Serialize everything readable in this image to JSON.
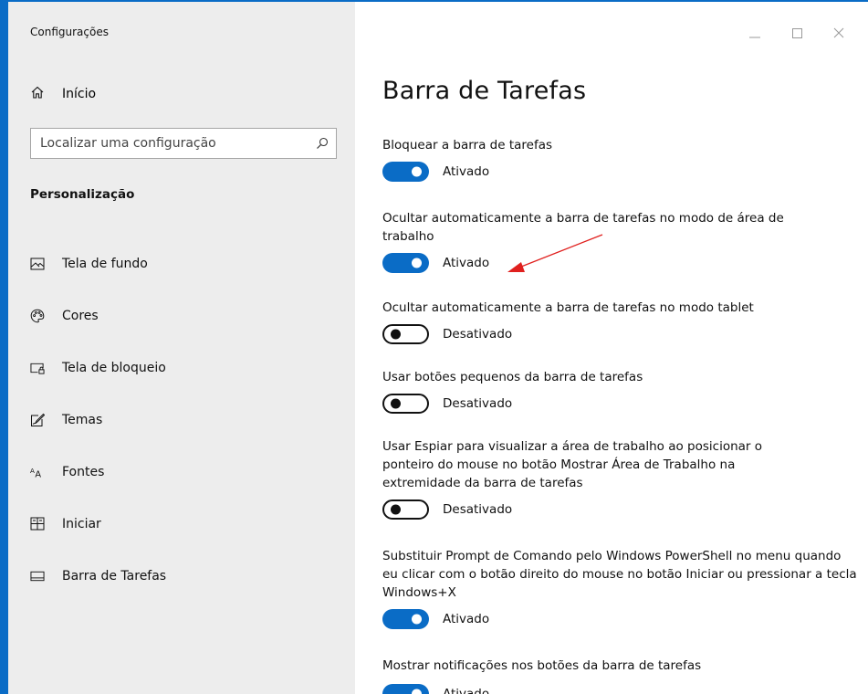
{
  "window": {
    "title": "Configurações",
    "accent": "#0a6cc6"
  },
  "sidebar": {
    "home_label": "Início",
    "search_placeholder": "Localizar uma configuração",
    "section_title": "Personalização",
    "items": [
      {
        "label": "Tela de fundo",
        "icon": "image-icon"
      },
      {
        "label": "Cores",
        "icon": "palette-icon"
      },
      {
        "label": "Tela de bloqueio",
        "icon": "lock-screen-icon"
      },
      {
        "label": "Temas",
        "icon": "themes-icon"
      },
      {
        "label": "Fontes",
        "icon": "fonts-icon"
      },
      {
        "label": "Iniciar",
        "icon": "start-icon"
      },
      {
        "label": "Barra de Tarefas",
        "icon": "taskbar-icon",
        "active": true
      }
    ]
  },
  "main": {
    "title": "Barra de Tarefas",
    "settings": [
      {
        "desc": "Bloquear a barra de tarefas",
        "state": "Ativado",
        "on": true
      },
      {
        "desc": "Ocultar automaticamente a barra de tarefas no modo de área de trabalho",
        "state": "Ativado",
        "on": true
      },
      {
        "desc": "Ocultar automaticamente a barra de tarefas no modo tablet",
        "state": "Desativado",
        "on": false
      },
      {
        "desc": "Usar botões pequenos da barra de tarefas",
        "state": "Desativado",
        "on": false
      },
      {
        "desc": "Usar Espiar para visualizar a área de trabalho ao posicionar o ponteiro do mouse no botão Mostrar Área de Trabalho na extremidade da barra de tarefas",
        "state": "Desativado",
        "on": false
      },
      {
        "desc": "Substituir Prompt de Comando pelo Windows PowerShell no menu quando eu clicar com o botão direito do mouse no botão Iniciar ou pressionar a tecla Windows+X",
        "state": "Ativado",
        "on": true
      },
      {
        "desc": "Mostrar notificações nos botões da barra de tarefas",
        "state": "Ativado",
        "on": true
      }
    ]
  }
}
